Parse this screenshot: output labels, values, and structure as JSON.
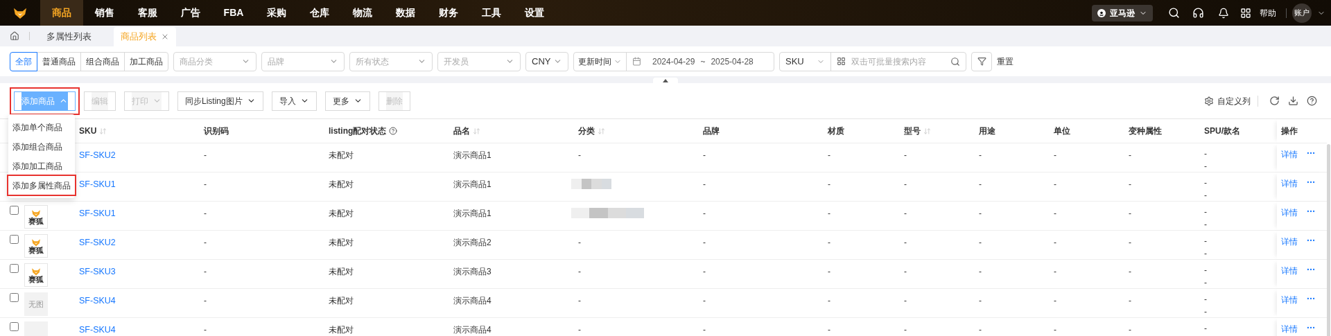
{
  "nav": {
    "items": [
      {
        "label": "商品",
        "selected": true
      },
      {
        "label": "销售",
        "selected": false
      },
      {
        "label": "客服",
        "selected": false
      },
      {
        "label": "广告",
        "selected": false
      },
      {
        "label": "FBA",
        "selected": false
      },
      {
        "label": "采购",
        "selected": false
      },
      {
        "label": "仓库",
        "selected": false
      },
      {
        "label": "物流",
        "selected": false
      },
      {
        "label": "数据",
        "selected": false
      },
      {
        "label": "财务",
        "selected": false
      },
      {
        "label": "工具",
        "selected": false
      },
      {
        "label": "设置",
        "selected": false
      }
    ],
    "marketplace": "亚马逊",
    "help": "帮助",
    "account": "账户"
  },
  "tabs": [
    {
      "label": "多属性列表",
      "selected": false,
      "closable": false
    },
    {
      "label": "商品列表",
      "selected": true,
      "closable": true
    }
  ],
  "filters": {
    "types": [
      {
        "label": "全部",
        "selected": true
      },
      {
        "label": "普通商品",
        "selected": false
      },
      {
        "label": "组合商品",
        "selected": false
      },
      {
        "label": "加工商品",
        "selected": false
      }
    ],
    "selects": [
      {
        "placeholder": "商品分类"
      },
      {
        "placeholder": "品牌"
      },
      {
        "placeholder": "所有状态"
      },
      {
        "placeholder": "开发员"
      }
    ],
    "currency": "CNY",
    "date_field": "更新时间",
    "date_start": "2024-04-29",
    "date_sep": "~",
    "date_end": "2025-04-28",
    "search_field": "SKU",
    "search_placeholder": "双击可批量搜索内容",
    "reset": "重置"
  },
  "toolbar": {
    "buttons": [
      {
        "label": "添加商品",
        "kind": "primary",
        "dropdown": true,
        "expanded": true,
        "disabled": false,
        "highlighted": true
      },
      {
        "label": "编辑",
        "kind": "default",
        "dropdown": false,
        "expanded": false,
        "disabled": true,
        "highlighted": false
      },
      {
        "label": "打印",
        "kind": "default",
        "dropdown": true,
        "expanded": false,
        "disabled": true,
        "highlighted": false
      },
      {
        "label": "同步Listing图片",
        "kind": "default",
        "dropdown": true,
        "expanded": false,
        "disabled": false,
        "highlighted": false
      },
      {
        "label": "导入",
        "kind": "default",
        "dropdown": true,
        "expanded": false,
        "disabled": false,
        "highlighted": false
      },
      {
        "label": "更多",
        "kind": "default",
        "dropdown": true,
        "expanded": false,
        "disabled": false,
        "highlighted": false
      },
      {
        "label": "删除",
        "kind": "default",
        "dropdown": false,
        "expanded": false,
        "disabled": true,
        "highlighted": false
      }
    ],
    "customize": "自定义列"
  },
  "add_menu": [
    {
      "label": "添加单个商品",
      "highlighted": false
    },
    {
      "label": "添加组合商品",
      "highlighted": false
    },
    {
      "label": "添加加工商品",
      "highlighted": false
    },
    {
      "label": "添加多属性商品",
      "highlighted": true
    }
  ],
  "table": {
    "columns": [
      {
        "label": "SKU",
        "sortable": true,
        "help": false
      },
      {
        "label": "识别码",
        "sortable": false,
        "help": false
      },
      {
        "label": "listing配对状态",
        "sortable": false,
        "help": true
      },
      {
        "label": "品名",
        "sortable": true,
        "help": false
      },
      {
        "label": "分类",
        "sortable": true,
        "help": false
      },
      {
        "label": "品牌",
        "sortable": false,
        "help": false
      },
      {
        "label": "材质",
        "sortable": false,
        "help": false
      },
      {
        "label": "型号",
        "sortable": true,
        "help": false
      },
      {
        "label": "用途",
        "sortable": false,
        "help": false
      },
      {
        "label": "单位",
        "sortable": false,
        "help": false
      },
      {
        "label": "变种属性",
        "sortable": false,
        "help": false
      },
      {
        "label": "SPU/款名",
        "sortable": false,
        "help": false
      },
      {
        "label": "操作",
        "sortable": false,
        "help": false
      }
    ],
    "rows": [
      {
        "cells": [
          "SF-SKU2",
          "-",
          "未配对",
          "演示商品1",
          "-",
          "-",
          "-",
          "-",
          "-",
          "-",
          "-"
        ],
        "spu": [
          "-",
          "-"
        ],
        "detail": "详情"
      },
      {
        "cells": [
          "SF-SKU1",
          "-",
          "未配对",
          "演示商品1",
          null,
          "-",
          "-",
          "-",
          "-",
          "-",
          "-"
        ],
        "spu": [
          "-",
          "-"
        ],
        "detail": "详情"
      },
      {
        "checked": false,
        "image": {
          "kind": "logo",
          "label": "赛狐"
        },
        "cells": [
          "SF-SKU1",
          "-",
          "未配对",
          "演示商品1",
          null,
          "-",
          "-",
          "-",
          "-",
          "-",
          "-"
        ],
        "spu": [
          "-",
          "-"
        ],
        "detail": "详情"
      },
      {
        "checked": false,
        "image": {
          "kind": "logo",
          "label": "赛狐"
        },
        "cells": [
          "SF-SKU2",
          "-",
          "未配对",
          "演示商品2",
          "-",
          "-",
          "-",
          "-",
          "-",
          "-",
          "-"
        ],
        "spu": [
          "-",
          "-"
        ],
        "detail": "详情"
      },
      {
        "checked": false,
        "image": {
          "kind": "logo",
          "label": "赛狐"
        },
        "cells": [
          "SF-SKU3",
          "-",
          "未配对",
          "演示商品3",
          "-",
          "-",
          "-",
          "-",
          "-",
          "-",
          "-"
        ],
        "spu": [
          "-",
          "-"
        ],
        "detail": "详情"
      },
      {
        "checked": false,
        "image": {
          "kind": "none",
          "label": "无图"
        },
        "cells": [
          "SF-SKU4",
          "-",
          "未配对",
          "演示商品4",
          "-",
          "-",
          "-",
          "-",
          "-",
          "-",
          "-"
        ],
        "spu": [
          "-",
          "-"
        ],
        "detail": "详情"
      },
      {
        "checked": false,
        "image": {
          "kind": "none"
        },
        "cells": [
          "SF-SKU4",
          "-",
          "未配对",
          "演示商品4",
          "-",
          "-",
          "-",
          "-",
          "-",
          "-",
          "-"
        ],
        "spu": [
          "-"
        ],
        "detail": "详情"
      }
    ]
  }
}
